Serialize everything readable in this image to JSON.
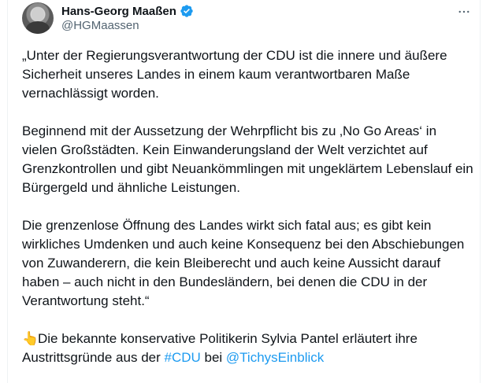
{
  "author": {
    "display_name": "Hans-Georg Maaßen",
    "handle": "@HGMaassen",
    "verified": true
  },
  "icons": {
    "avatar": "profile-photo",
    "verified": "verified-badge-icon",
    "more": "more-options-icon"
  },
  "colors": {
    "verified": "#1d9bf0",
    "link": "#1d9bf0",
    "secondary_text": "#536471"
  },
  "tweet": {
    "p1": "„Unter der Regierungsverantwortung der CDU ist die innere und äußere Sicherheit unseres Landes in einem kaum verantwortbaren Maße vernachlässigt worden.",
    "p2": "Beginnend mit der Aussetzung der Wehrpflicht bis zu ‚No Go Areas‘ in vielen Großstädten. Kein Einwanderungsland der Welt verzichtet auf Grenzkontrollen und gibt Neuankömmlingen mit ungeklärtem Lebenslauf ein Bürgergeld und ähnliche Leistungen.",
    "p3": "Die grenzenlose Öffnung des Landes wirkt sich fatal aus; es gibt kein wirkliches Umdenken und auch keine Konsequenz bei den Abschiebungen von Zuwanderern, die kein Bleiberecht und auch keine Aussicht darauf haben – auch nicht in den Bundesländern, bei denen die CDU in der Verantwortung steht.“",
    "p4": {
      "emoji": "👆",
      "text_before": "Die bekannte konservative Politikerin Sylvia Pantel erläutert ihre Austrittsgründe aus der ",
      "hashtag": "#CDU",
      "text_middle": " bei ",
      "mention": "@TichysEinblick"
    }
  }
}
